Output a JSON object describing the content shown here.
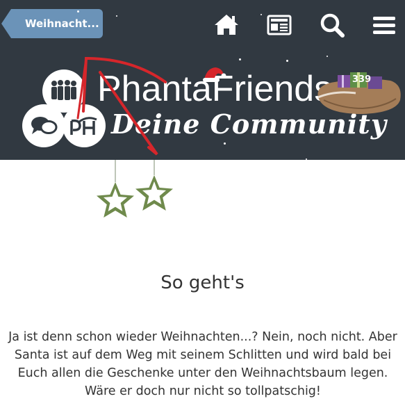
{
  "header": {
    "back_label": "Weihnacht...",
    "icons": [
      "home-icon",
      "news-icon",
      "search-icon",
      "menu-icon"
    ]
  },
  "banner": {
    "brand": "PhantaFriends",
    "tagline": "Deine Community",
    "badge_count": "339"
  },
  "content": {
    "heading": "So geht's",
    "text": "Ja ist denn schon wieder Weihnachten...? Nein, noch nicht. Aber Santa ist auf dem Weg mit seinem Schlitten und wird bald bei Euch allen die Geschenke unter den Weihnachtsbaum legen. Wäre er doch nur nicht so tollpatschig!"
  },
  "colors": {
    "bar": "#313941",
    "back_button": "#6b93b8",
    "star": "#6f8a4c",
    "ribbon": "#d6262b"
  }
}
